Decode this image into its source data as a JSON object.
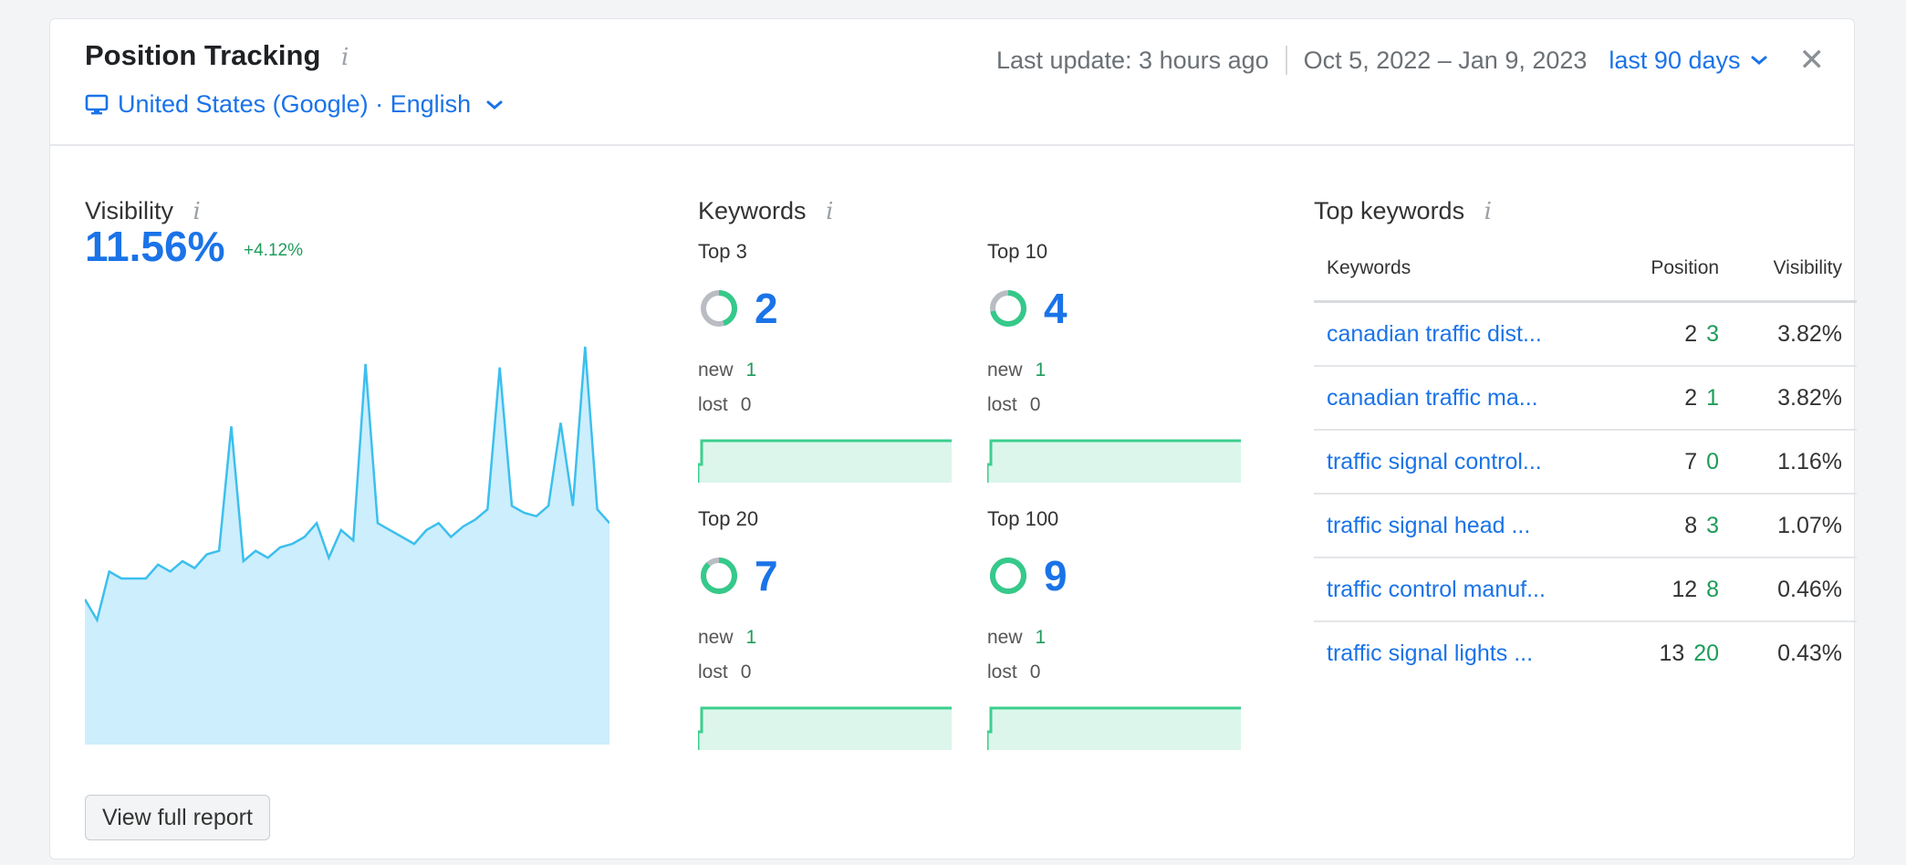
{
  "header": {
    "title": "Position Tracking",
    "info_glyph": "i",
    "location": "United States (Google) · English",
    "last_update": "Last update: 3 hours ago",
    "date_range": "Oct 5, 2022 – Jan 9, 2023",
    "period": "last 90 days",
    "close_glyph": "✕"
  },
  "visibility": {
    "label": "Visibility",
    "value": "11.56%",
    "delta": "+4.12%",
    "series": [
      4.2,
      3.6,
      5.0,
      4.8,
      4.8,
      4.8,
      5.2,
      5.0,
      5.3,
      5.1,
      5.5,
      5.6,
      9.2,
      5.3,
      5.6,
      5.4,
      5.7,
      5.8,
      6.0,
      6.4,
      5.4,
      6.2,
      5.9,
      11.0,
      6.4,
      6.2,
      6.0,
      5.8,
      6.2,
      6.4,
      6.0,
      6.3,
      6.5,
      6.8,
      10.9,
      6.9,
      6.7,
      6.6,
      6.9,
      9.3,
      6.9,
      11.5,
      6.8,
      6.4
    ]
  },
  "keywords": {
    "label": "Keywords",
    "blocks": [
      {
        "label": "Top 3",
        "count": "2",
        "new_label": "new",
        "new": "1",
        "lost_label": "lost",
        "lost": "0",
        "fill": 0.45
      },
      {
        "label": "Top 10",
        "count": "4",
        "new_label": "new",
        "new": "1",
        "lost_label": "lost",
        "lost": "0",
        "fill": 0.72
      },
      {
        "label": "Top 20",
        "count": "7",
        "new_label": "new",
        "new": "1",
        "lost_label": "lost",
        "lost": "0",
        "fill": 0.88
      },
      {
        "label": "Top 100",
        "count": "9",
        "new_label": "new",
        "new": "1",
        "lost_label": "lost",
        "lost": "0",
        "fill": 1.0
      }
    ]
  },
  "top_keywords": {
    "label": "Top keywords",
    "columns": [
      "Keywords",
      "Position",
      "Visibility"
    ],
    "rows": [
      {
        "keyword": "canadian traffic dist...",
        "position": "2",
        "prev": "3",
        "visibility": "3.82%"
      },
      {
        "keyword": "canadian traffic ma...",
        "position": "2",
        "prev": "1",
        "visibility": "3.82%"
      },
      {
        "keyword": "traffic signal control...",
        "position": "7",
        "prev": "0",
        "visibility": "1.16%"
      },
      {
        "keyword": "traffic signal head ...",
        "position": "8",
        "prev": "3",
        "visibility": "1.07%"
      },
      {
        "keyword": "traffic control manuf...",
        "position": "12",
        "prev": "8",
        "visibility": "0.46%"
      },
      {
        "keyword": "traffic signal lights ...",
        "position": "13",
        "prev": "20",
        "visibility": "0.43%"
      }
    ]
  },
  "footer": {
    "button": "View full report"
  },
  "colors": {
    "accent_blue": "#1a73e8",
    "positive_green": "#1e9c5a",
    "visibility_fill": "#cdeefc",
    "visibility_line": "#3cbfee",
    "spark_fill": "#dcf6ec",
    "spark_line": "#3ccf8e",
    "donut_gray": "#b9bdc3",
    "donut_green": "#35c98a"
  },
  "icons": {
    "monitor": "monitor-icon",
    "chevron": "chevron-down-icon",
    "close": "close-icon",
    "info": "info-icon"
  }
}
